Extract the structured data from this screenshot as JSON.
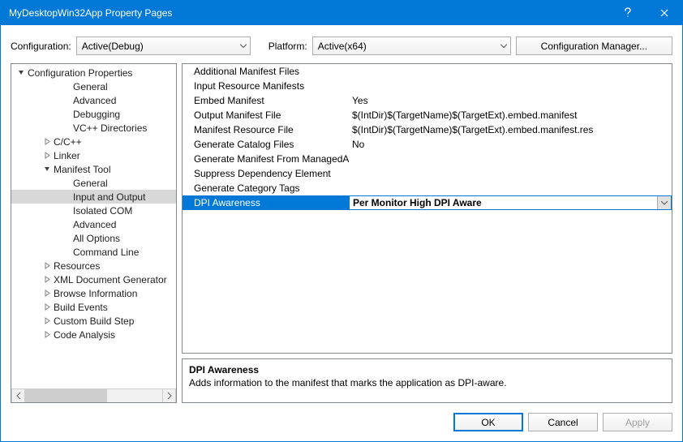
{
  "titlebar": {
    "title": "MyDesktopWin32App Property Pages"
  },
  "toprow": {
    "config_label": "Configuration:",
    "config_value": "Active(Debug)",
    "platform_label": "Platform:",
    "platform_value": "Active(x64)",
    "cfgmgr_label": "Configuration Manager..."
  },
  "tree": {
    "root": "Configuration Properties",
    "items": [
      {
        "label": "General",
        "indent": 2,
        "exp": ""
      },
      {
        "label": "Advanced",
        "indent": 2,
        "exp": ""
      },
      {
        "label": "Debugging",
        "indent": 2,
        "exp": ""
      },
      {
        "label": "VC++ Directories",
        "indent": 2,
        "exp": ""
      },
      {
        "label": "C/C++",
        "indent": 1,
        "exp": "closed"
      },
      {
        "label": "Linker",
        "indent": 1,
        "exp": "closed"
      },
      {
        "label": "Manifest Tool",
        "indent": 1,
        "exp": "open"
      },
      {
        "label": "General",
        "indent": 2,
        "exp": ""
      },
      {
        "label": "Input and Output",
        "indent": 2,
        "exp": "",
        "selected": true
      },
      {
        "label": "Isolated COM",
        "indent": 2,
        "exp": ""
      },
      {
        "label": "Advanced",
        "indent": 2,
        "exp": ""
      },
      {
        "label": "All Options",
        "indent": 2,
        "exp": ""
      },
      {
        "label": "Command Line",
        "indent": 2,
        "exp": ""
      },
      {
        "label": "Resources",
        "indent": 1,
        "exp": "closed"
      },
      {
        "label": "XML Document Generator",
        "indent": 1,
        "exp": "closed"
      },
      {
        "label": "Browse Information",
        "indent": 1,
        "exp": "closed"
      },
      {
        "label": "Build Events",
        "indent": 1,
        "exp": "closed"
      },
      {
        "label": "Custom Build Step",
        "indent": 1,
        "exp": "closed"
      },
      {
        "label": "Code Analysis",
        "indent": 1,
        "exp": "closed"
      }
    ]
  },
  "grid": {
    "rows": [
      {
        "name": "Additional Manifest Files",
        "value": ""
      },
      {
        "name": "Input Resource Manifests",
        "value": ""
      },
      {
        "name": "Embed Manifest",
        "value": "Yes"
      },
      {
        "name": "Output Manifest File",
        "value": "$(IntDir)$(TargetName)$(TargetExt).embed.manifest"
      },
      {
        "name": "Manifest Resource File",
        "value": "$(IntDir)$(TargetName)$(TargetExt).embed.manifest.res"
      },
      {
        "name": "Generate Catalog Files",
        "value": "No"
      },
      {
        "name": "Generate Manifest From ManagedAssembly",
        "value": ""
      },
      {
        "name": "Suppress Dependency Element",
        "value": ""
      },
      {
        "name": "Generate Category Tags",
        "value": ""
      },
      {
        "name": "DPI Awareness",
        "value": "Per Monitor High DPI Aware",
        "selected": true
      }
    ]
  },
  "desc": {
    "title": "DPI Awareness",
    "text": "Adds information to the manifest that marks the application as DPI-aware."
  },
  "footer": {
    "ok": "OK",
    "cancel": "Cancel",
    "apply": "Apply"
  }
}
